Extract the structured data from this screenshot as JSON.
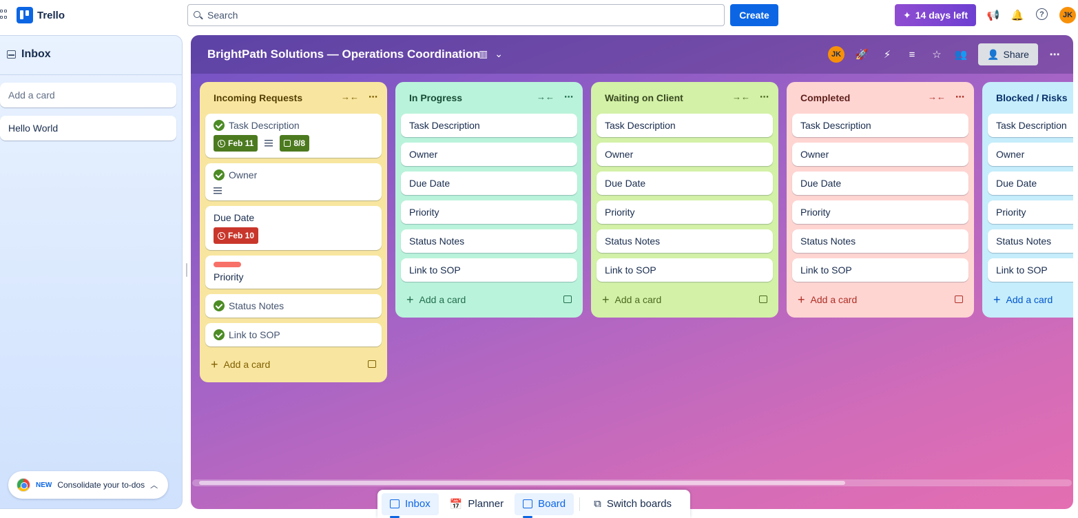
{
  "topbar": {
    "app_name": "Trello",
    "search_placeholder": "Search",
    "create_label": "Create",
    "trial_label": "14 days left",
    "user_initials": "JK"
  },
  "inbox": {
    "title": "Inbox",
    "add_placeholder": "Add a card",
    "cards": [
      "Hello World"
    ],
    "promo_new": "NEW",
    "promo_text": "Consolidate your to-dos"
  },
  "board": {
    "title": "BrightPath Solutions — Operations Coordination",
    "share_label": "Share",
    "member_initials": "JK",
    "lists": [
      {
        "name": "Incoming Requests",
        "add_label": "Add a card",
        "cards": [
          {
            "title": "Task Description",
            "done": true,
            "due": "Feb 11",
            "checklist": "8/8",
            "has_description": true
          },
          {
            "title": "Owner",
            "done": true,
            "has_description": true
          },
          {
            "title": "Due Date",
            "due_overdue": "Feb 10"
          },
          {
            "title": "Priority",
            "label_color": "#f87168"
          },
          {
            "title": "Status Notes",
            "done": true
          },
          {
            "title": "Link to SOP",
            "done": true
          }
        ]
      },
      {
        "name": "In Progress",
        "add_label": "Add a card",
        "cards": [
          "Task Description",
          "Owner",
          "Due Date",
          "Priority",
          "Status Notes",
          "Link to SOP"
        ]
      },
      {
        "name": "Waiting on Client",
        "add_label": "Add a card",
        "cards": [
          "Task Description",
          "Owner",
          "Due Date",
          "Priority",
          "Status Notes",
          "Link to SOP"
        ]
      },
      {
        "name": "Completed",
        "add_label": "Add a card",
        "cards": [
          "Task Description",
          "Owner",
          "Due Date",
          "Priority",
          "Status Notes",
          "Link to SOP"
        ]
      },
      {
        "name": "Blocked / Risks",
        "add_label": "Add a card",
        "cards": [
          "Task Description",
          "Owner",
          "Due Date",
          "Priority",
          "Status Notes",
          "Link to SOP"
        ]
      }
    ]
  },
  "switcher": {
    "inbox": "Inbox",
    "planner": "Planner",
    "board": "Board",
    "switch_boards": "Switch boards"
  },
  "colors": {
    "primary": "#0c66e4",
    "trial": "#8f4dd1",
    "list_yellow": "#f8e6a0",
    "list_green": "#baf3db",
    "list_lime": "#d3f1a7",
    "list_red": "#ffd5d2",
    "list_blue": "#c6edfb"
  }
}
